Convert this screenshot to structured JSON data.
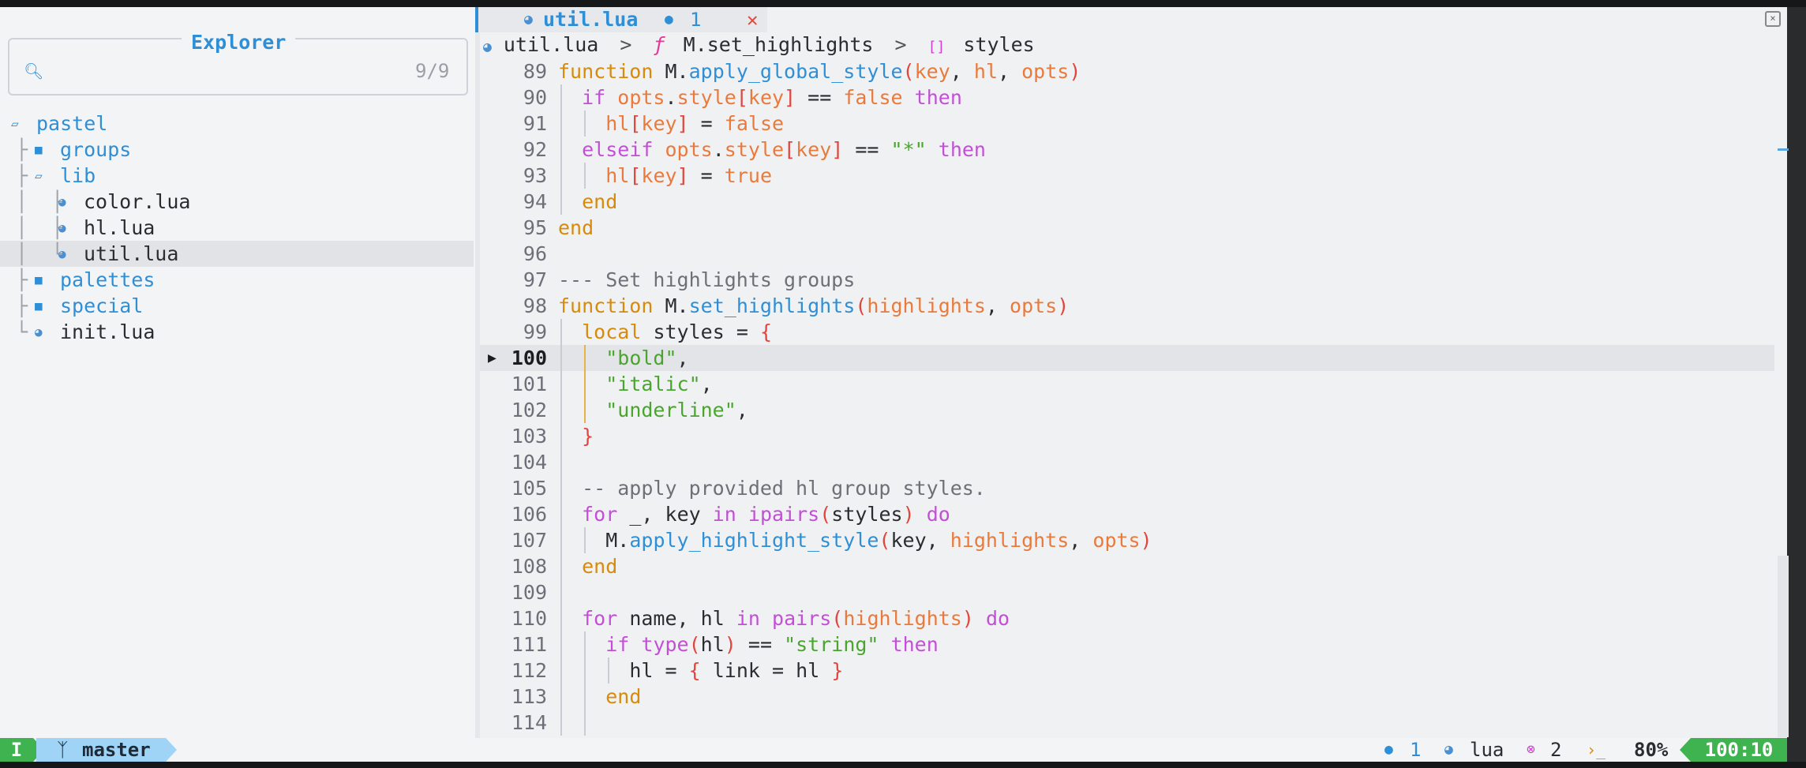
{
  "colors": {
    "accent": "#2f8fd6",
    "mode_green": "#3fb34f",
    "branch_bg": "#9fd4f6",
    "keyword": "#d88a0a",
    "keyword2": "#c34fd7",
    "string": "#4aa52e",
    "param": "#ea7a3c",
    "close": "#e24a3a"
  },
  "explorer": {
    "title": "Explorer",
    "search_icon": "search-icon",
    "count": "9/9",
    "tree": [
      {
        "label": "pastel",
        "type": "folder-open",
        "guide": ""
      },
      {
        "label": "groups",
        "type": "folder",
        "guide": "├"
      },
      {
        "label": "lib",
        "type": "folder-open",
        "guide": "├"
      },
      {
        "label": "color.lua",
        "type": "file",
        "guide": "│ ├"
      },
      {
        "label": "hl.lua",
        "type": "file",
        "guide": "│ ├"
      },
      {
        "label": "util.lua",
        "type": "file",
        "guide": "│ └",
        "selected": true
      },
      {
        "label": "palettes",
        "type": "folder",
        "guide": "├"
      },
      {
        "label": "special",
        "type": "folder",
        "guide": "├"
      },
      {
        "label": "init.lua",
        "type": "file",
        "guide": "└"
      }
    ]
  },
  "tab": {
    "name": "util.lua",
    "diagnostics": "1",
    "close_icon": "close-icon"
  },
  "breadcrumb": {
    "file": "util.lua",
    "separator": ">",
    "function": "M.set_highlights",
    "variable": "styles"
  },
  "editor": {
    "current_line": "100",
    "lines": [
      {
        "n": "89",
        "text": "function M.apply_global_style(key, hl, opts)"
      },
      {
        "n": "90",
        "text": "  if opts.style[key] == false then"
      },
      {
        "n": "91",
        "text": "    hl[key] = false"
      },
      {
        "n": "92",
        "text": "  elseif opts.style[key] == \"*\" then"
      },
      {
        "n": "93",
        "text": "    hl[key] = true"
      },
      {
        "n": "94",
        "text": "  end"
      },
      {
        "n": "95",
        "text": "end"
      },
      {
        "n": "96",
        "text": ""
      },
      {
        "n": "97",
        "text": "--- Set highlights groups"
      },
      {
        "n": "98",
        "text": "function M.set_highlights(highlights, opts)"
      },
      {
        "n": "99",
        "text": "  local styles = {"
      },
      {
        "n": "100",
        "text": "    \"bold\","
      },
      {
        "n": "101",
        "text": "    \"italic\","
      },
      {
        "n": "102",
        "text": "    \"underline\","
      },
      {
        "n": "103",
        "text": "  }"
      },
      {
        "n": "104",
        "text": ""
      },
      {
        "n": "105",
        "text": "  -- apply provided hl group styles."
      },
      {
        "n": "106",
        "text": "  for _, key in ipairs(styles) do"
      },
      {
        "n": "107",
        "text": "    M.apply_highlight_style(key, highlights, opts)"
      },
      {
        "n": "108",
        "text": "  end"
      },
      {
        "n": "109",
        "text": ""
      },
      {
        "n": "110",
        "text": "  for name, hl in pairs(highlights) do"
      },
      {
        "n": "111",
        "text": "    if type(hl) == \"string\" then"
      },
      {
        "n": "112",
        "text": "      hl = { link = hl }"
      },
      {
        "n": "113",
        "text": "    end"
      },
      {
        "n": "114",
        "text": ""
      }
    ]
  },
  "statusbar": {
    "mode": "I",
    "branch_icon": "git-branch-icon",
    "branch": "master",
    "diagnostics": "1",
    "filetype": "lua",
    "errors": "2",
    "percent": "80%",
    "position": "100:10"
  }
}
